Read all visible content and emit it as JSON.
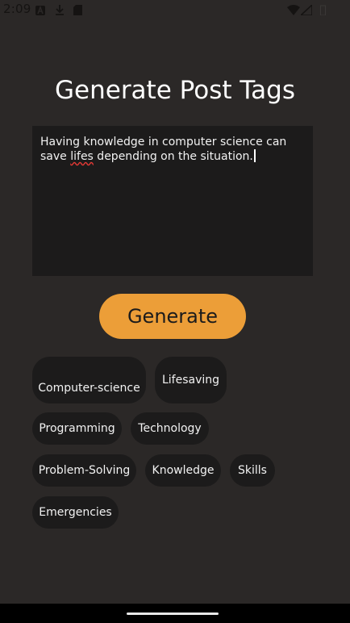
{
  "status_bar": {
    "time": "2:09"
  },
  "title": "Generate Post Tags",
  "input": {
    "text_before": "Having knowledge in computer science can save ",
    "misspelled_word": "lifes",
    "text_after": " depending on the situation."
  },
  "generate_button": {
    "label": "Generate"
  },
  "tags": [
    "Computer-science",
    "Lifesaving",
    "Programming",
    "Technology",
    "Problem-Solving",
    "Knowledge",
    "Skills",
    "Emergencies"
  ],
  "colors": {
    "background": "#2b2827",
    "surface": "#1c1b1b",
    "accent": "#ec9e38",
    "spell_error": "#e53935"
  },
  "icons": {
    "status": [
      "app-a-icon",
      "download-icon",
      "sd-card-icon",
      "wifi-icon",
      "signal-icon",
      "battery-icon"
    ]
  }
}
